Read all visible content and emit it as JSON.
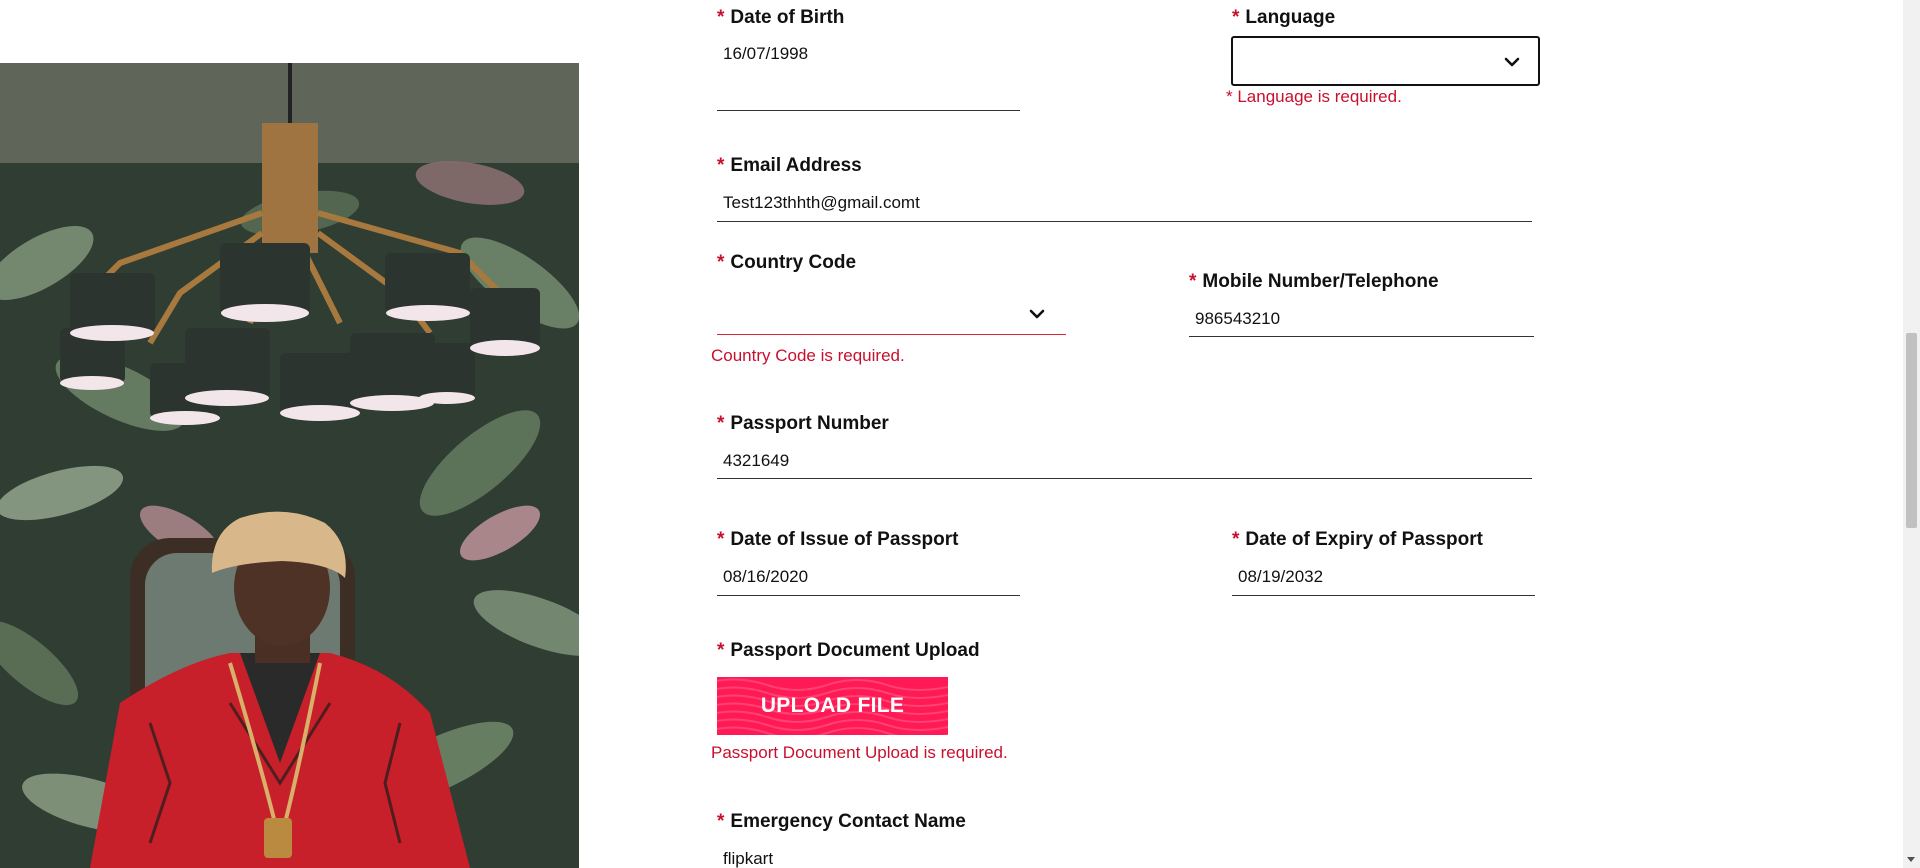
{
  "form": {
    "required_mark": "*",
    "dob": {
      "label": "Date of Birth",
      "value": "16/07/1998"
    },
    "language": {
      "label": "Language",
      "value": "",
      "error": "* Language is required."
    },
    "email": {
      "label": "Email Address",
      "value": "Test123thhth@gmail.comt"
    },
    "country_code": {
      "label": "Country Code",
      "value": "",
      "error": "Country Code is required."
    },
    "mobile": {
      "label": "Mobile Number/Telephone",
      "value": "986543210"
    },
    "passport_number": {
      "label": "Passport Number",
      "value": "4321649"
    },
    "issue_date": {
      "label": "Date of Issue of Passport",
      "value": "08/16/2020"
    },
    "expiry_date": {
      "label": "Date of Expiry of Passport",
      "value": "08/19/2032"
    },
    "passport_upload": {
      "label": "Passport Document Upload",
      "button_label": "UPLOAD FILE",
      "error": "Passport Document Upload is required."
    },
    "emergency_name": {
      "label": "Emergency Contact Name",
      "value": "flipkart"
    }
  },
  "icons": {
    "select_chevron": "chevron-down-icon",
    "scroll_down": "arrow-down-icon"
  },
  "colors": {
    "required": "#c8102e",
    "error": "#c8102e",
    "upload_button": "#ff1a55",
    "error_underline": "#d9243a"
  }
}
